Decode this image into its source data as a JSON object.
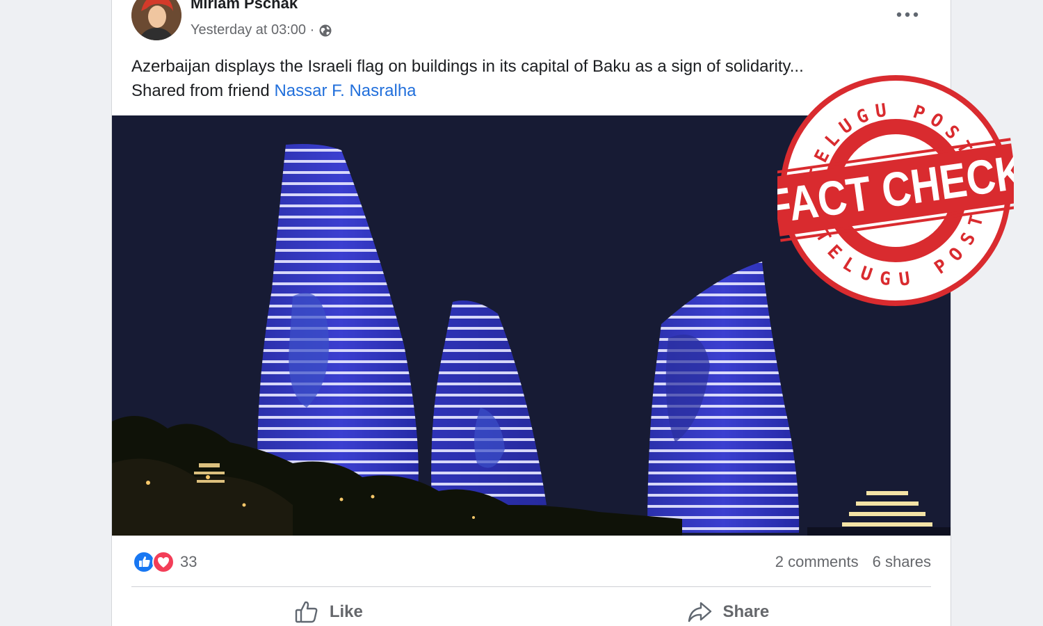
{
  "post": {
    "author": "Miriam Pschak",
    "timestamp": "Yesterday at 03:00 ·",
    "privacy_icon": "globe-icon",
    "caption_text": "Azerbaijan displays the Israeli flag on buildings in its capital of Baku as a sign of solidarity...",
    "shared_prefix": "Shared from friend",
    "shared_friend": "Nassar F. Nasralha",
    "image_description_icon": "photo"
  },
  "stats": {
    "reaction_count": "33",
    "comments": "2 comments",
    "shares": "6 shares"
  },
  "actions": {
    "like_label": "Like",
    "share_label": "Share"
  },
  "stamp": {
    "top_text": "TELUGU POST",
    "main_text": "FACT CHECK",
    "bottom_text": "TELUGU POST"
  },
  "colors": {
    "link": "#216fdb",
    "like_blue": "#1877f2",
    "love_red": "#f33e58",
    "stamp_red": "#d92b2f"
  }
}
